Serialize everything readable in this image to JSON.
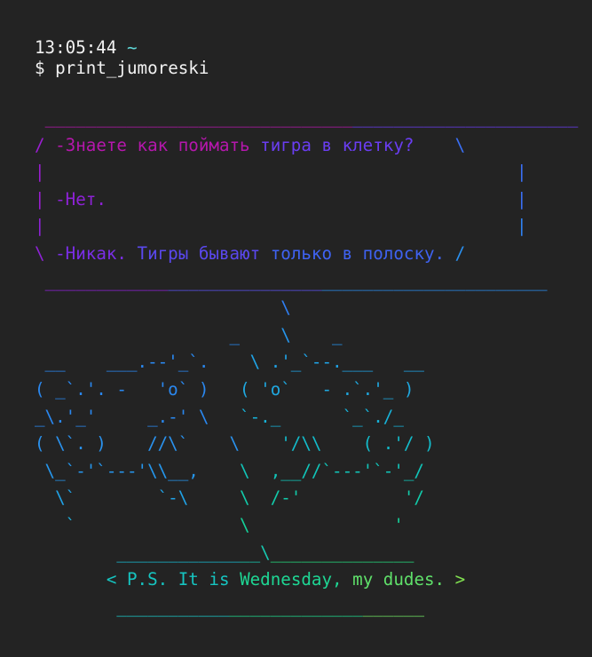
{
  "prompt": {
    "time": "13:05:44",
    "dir": "~",
    "dollar": "$",
    "command": "print_jumoreski"
  },
  "art_rows": [
    [
      {
        "t": " ",
        "c": "#232323"
      },
      {
        "t": "______________________________",
        "c": "#b517ac"
      },
      {
        "t": "______________________",
        "c": "#6a3df2"
      }
    ],
    [
      {
        "t": "/ ",
        "c": "#9a1ed0"
      },
      {
        "t": "-Знаете как поймать ",
        "c": "#b517ac"
      },
      {
        "t": "тигра в клетку?",
        "c": "#6a3df2"
      },
      {
        "t": "    \\",
        "c": "#3a6ff5"
      }
    ],
    [
      {
        "t": "|",
        "c": "#9a1ed0"
      },
      {
        "t": "                                              |",
        "c": "#3a6ff5"
      }
    ],
    [
      {
        "t": "| ",
        "c": "#9a1ed0"
      },
      {
        "t": "-Нет.",
        "c": "#8e22d6"
      },
      {
        "t": "                                        |",
        "c": "#3a6ff5"
      }
    ],
    [
      {
        "t": "|",
        "c": "#8e22d6"
      },
      {
        "t": "                                              |",
        "c": "#2f82f3"
      }
    ],
    [
      {
        "t": "\\ ",
        "c": "#8e22d6"
      },
      {
        "t": "-Никак. ",
        "c": "#7a2ee6"
      },
      {
        "t": "Тигры бывают ",
        "c": "#5a48ee"
      },
      {
        "t": "только в полоску.",
        "c": "#3f63f3"
      },
      {
        "t": " /",
        "c": "#2a90f0"
      }
    ],
    [
      {
        "t": " ",
        "c": "#232323"
      },
      {
        "t": "____________",
        "c": "#8e22d6"
      },
      {
        "t": "_______________",
        "c": "#5a50f0"
      },
      {
        "t": "______________________",
        "c": "#2b8cef"
      }
    ],
    [
      {
        "t": "                        \\",
        "c": "#2f7ff2"
      }
    ],
    [
      {
        "t": "                   _    ",
        "c": "#2a88f0"
      },
      {
        "t": "\\    _",
        "c": "#2696ec"
      }
    ],
    [
      {
        "t": " __    ___.--'_`.    ",
        "c": "#2a88f0"
      },
      {
        "t": "\\ .'_`--.___   __",
        "c": "#1fa3e6"
      }
    ],
    [
      {
        "t": "( _`.'. -   'o` )   ",
        "c": "#2a88f0"
      },
      {
        "t": "( 'o`   - .`.'_ )",
        "c": "#1fa8e0"
      }
    ],
    [
      {
        "t": "_\\.'_'     _.-' \\   ",
        "c": "#2a88f0"
      },
      {
        "t": "`-._      `_`./_",
        "c": "#17b2d8"
      }
    ],
    [
      {
        "t": "( \\`. )    //\\`    \\    ",
        "c": "#2a92ee"
      },
      {
        "t": "'/\\\\    ( .'/ )",
        "c": "#13bccb"
      }
    ],
    [
      {
        "t": " \\_`-'`---'\\\\__,    ",
        "c": "#2596ec"
      },
      {
        "t": "\\  ,__//`---'`-'_/",
        "c": "#11c4b8"
      }
    ],
    [
      {
        "t": "  \\`        `-\\     ",
        "c": "#20a2e6"
      },
      {
        "t": "\\  /-'          '/",
        "c": "#12cbaa"
      }
    ],
    [
      {
        "t": "   `                ",
        "c": "#1fb0dc"
      },
      {
        "t": "\\              '",
        "c": "#15d19a"
      }
    ],
    [
      {
        "t": "        ",
        "c": "#232323"
      },
      {
        "t": "____________",
        "c": "#1abad0"
      },
      {
        "t": "__\\",
        "c": "#17c8b0"
      },
      {
        "t": "______________",
        "c": "#24d87e"
      }
    ],
    [
      {
        "t": "       ",
        "c": "#232323"
      },
      {
        "t": "< P.S. It is ",
        "c": "#16c4c0"
      },
      {
        "t": "Wednesday, ",
        "c": "#1ed694"
      },
      {
        "t": "my dudes.",
        "c": "#5fe06a"
      },
      {
        "t": " >",
        "c": "#80e050"
      }
    ],
    [
      {
        "t": "        ",
        "c": "#232323"
      },
      {
        "t": "___________",
        "c": "#1bc6c4"
      },
      {
        "t": "_____________",
        "c": "#1fd88c"
      },
      {
        "t": "______",
        "c": "#6ee060"
      }
    ]
  ]
}
